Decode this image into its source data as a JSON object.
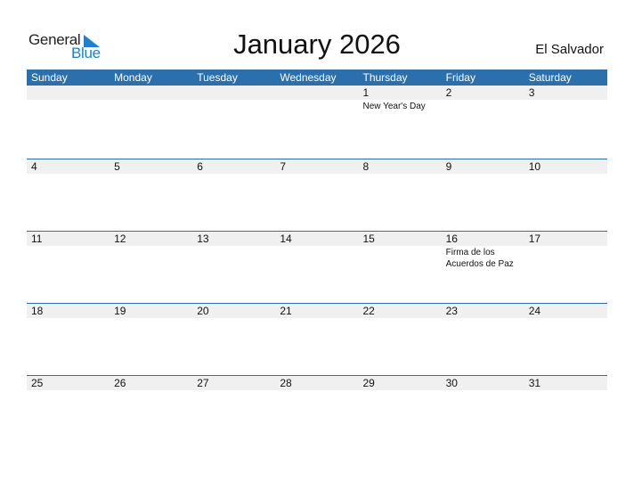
{
  "logo": {
    "line1": "General",
    "line2": "Blue"
  },
  "title": "January 2026",
  "country": "El Salvador",
  "colors": {
    "header": "#2c6fad",
    "date_strip": "#f0f0f0",
    "logo_blue": "#1f7fd1"
  },
  "weekdays": [
    "Sunday",
    "Monday",
    "Tuesday",
    "Wednesday",
    "Thursday",
    "Friday",
    "Saturday"
  ],
  "weeks": [
    {
      "days": [
        "",
        "",
        "",
        "",
        "1",
        "2",
        "3"
      ],
      "events": [
        "",
        "",
        "",
        "",
        "New Year's Day",
        "",
        ""
      ]
    },
    {
      "days": [
        "4",
        "5",
        "6",
        "7",
        "8",
        "9",
        "10"
      ],
      "events": [
        "",
        "",
        "",
        "",
        "",
        "",
        ""
      ]
    },
    {
      "days": [
        "11",
        "12",
        "13",
        "14",
        "15",
        "16",
        "17"
      ],
      "events": [
        "",
        "",
        "",
        "",
        "",
        "Firma de los Acuerdos de Paz",
        ""
      ]
    },
    {
      "days": [
        "18",
        "19",
        "20",
        "21",
        "22",
        "23",
        "24"
      ],
      "events": [
        "",
        "",
        "",
        "",
        "",
        "",
        ""
      ]
    },
    {
      "days": [
        "25",
        "26",
        "27",
        "28",
        "29",
        "30",
        "31"
      ],
      "events": [
        "",
        "",
        "",
        "",
        "",
        "",
        ""
      ]
    }
  ]
}
